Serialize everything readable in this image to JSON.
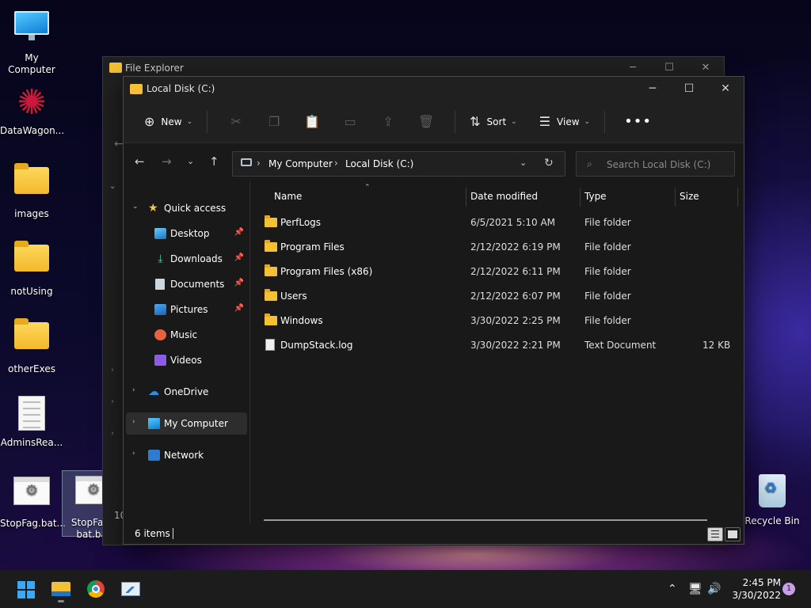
{
  "desktop": {
    "icons": [
      {
        "label": "My Computer",
        "icon": "monitor-icon"
      },
      {
        "label": "DataWagon...",
        "icon": "datawagon-icon"
      },
      {
        "label": "images",
        "icon": "folder-icon"
      },
      {
        "label": "notUsing",
        "icon": "folder-icon"
      },
      {
        "label": "otherExes",
        "icon": "folder-icon"
      },
      {
        "label": "AdminsRea...",
        "icon": "text-file-icon"
      },
      {
        "label": "StopFag.bat...",
        "icon": "batch-file-icon"
      },
      {
        "label": "StopFagA bat.bat",
        "icon": "batch-file-icon"
      },
      {
        "label": "Recycle Bin",
        "icon": "recycle-bin-icon"
      }
    ],
    "back_window_fragment": "10"
  },
  "back_window": {
    "title": "File Explorer"
  },
  "window": {
    "title": "Local Disk (C:)",
    "caption_buttons": {
      "minimize": "─",
      "maximize": "☐",
      "close": "✕"
    }
  },
  "toolbar": {
    "new_label": "New",
    "sort_label": "Sort",
    "view_label": "View",
    "more_label": "•••",
    "disabled_icons": [
      "cut-icon",
      "copy-icon",
      "paste-icon",
      "rename-icon",
      "share-icon",
      "delete-icon"
    ]
  },
  "address": {
    "crumbs": [
      "My Computer",
      "Local Disk (C:)"
    ],
    "separator": "›"
  },
  "search": {
    "placeholder": "Search Local Disk (C:)"
  },
  "nav_pane": {
    "quick_access": "Quick access",
    "pinned": [
      "Desktop",
      "Downloads",
      "Documents",
      "Pictures"
    ],
    "unpinned": [
      "Music",
      "Videos"
    ],
    "onedrive": "OneDrive",
    "my_computer": "My Computer",
    "network": "Network"
  },
  "file_list": {
    "columns": [
      "Name",
      "Date modified",
      "Type",
      "Size"
    ],
    "rows": [
      {
        "name": "PerfLogs",
        "date": "6/5/2021 5:10 AM",
        "type": "File folder",
        "size": "",
        "icon": "folder-icon"
      },
      {
        "name": "Program Files",
        "date": "2/12/2022 6:19 PM",
        "type": "File folder",
        "size": "",
        "icon": "folder-icon"
      },
      {
        "name": "Program Files (x86)",
        "date": "2/12/2022 6:11 PM",
        "type": "File folder",
        "size": "",
        "icon": "folder-icon"
      },
      {
        "name": "Users",
        "date": "2/12/2022 6:07 PM",
        "type": "File folder",
        "size": "",
        "icon": "folder-icon"
      },
      {
        "name": "Windows",
        "date": "3/30/2022 2:25 PM",
        "type": "File folder",
        "size": "",
        "icon": "folder-icon"
      },
      {
        "name": "DumpStack.log",
        "date": "3/30/2022 2:21 PM",
        "type": "Text Document",
        "size": "12 KB",
        "icon": "text-file-icon"
      }
    ]
  },
  "status": {
    "items_count": "6 items"
  },
  "taskbar": {
    "time": "2:45 PM",
    "date": "3/30/2022",
    "notification_count": "1",
    "apps": [
      "start-icon",
      "file-explorer-icon",
      "chrome-icon",
      "performance-monitor-icon"
    ]
  },
  "colors": {
    "accent": "#3ba7f5",
    "folder": "#f4c136",
    "window_bg": "#191919"
  }
}
